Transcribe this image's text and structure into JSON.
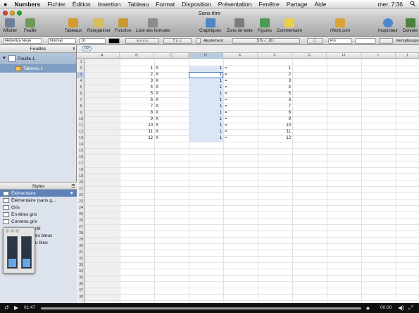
{
  "menubar": {
    "apple_icon": "apple-logo-icon",
    "app_name": "Numbers",
    "items": [
      "Fichier",
      "Édition",
      "Insertion",
      "Tableau",
      "Format",
      "Disposition",
      "Présentation",
      "Fenêtre",
      "Partage",
      "Aide"
    ],
    "clock": "mer. 7:36",
    "spotlight_icon": "search-icon"
  },
  "window": {
    "title": "Sans titre"
  },
  "toolbar": {
    "items": [
      {
        "label": "Afficher",
        "icon": "view-icon",
        "color": "#6f7f97"
      },
      {
        "label": "Feuille",
        "icon": "sheet-icon",
        "color": "#6f9a57"
      },
      {
        "label": "Tableaux",
        "icon": "table-icon",
        "color": "#d59b2f"
      },
      {
        "label": "Réorganiser",
        "icon": "reorganize-icon",
        "color": "#d6bc5d"
      },
      {
        "label": "Fonction",
        "icon": "function-icon",
        "color": "#c99a33"
      },
      {
        "label": "Liste des formules",
        "icon": "formula-list-icon",
        "color": "#8b8b8b"
      },
      {
        "label": "Graphiques",
        "icon": "charts-icon",
        "color": "#4f86c6"
      },
      {
        "label": "Zone de texte",
        "icon": "textbox-icon",
        "color": "#7d7d7d"
      },
      {
        "label": "Figures",
        "icon": "shapes-icon",
        "color": "#4d9a53"
      },
      {
        "label": "Commentaire",
        "icon": "comment-icon",
        "color": "#e7cf46"
      },
      {
        "label": "iWork.com",
        "icon": "iwork-icon",
        "color": "#d9a53a"
      },
      {
        "label": "Inspecteur",
        "icon": "inspector-icon",
        "color": "#4b87c9"
      },
      {
        "label": "Donnée",
        "icon": "data-icon",
        "color": "#4a7f3d"
      }
    ]
  },
  "formatbar": {
    "font": "Helvetica Neue",
    "style": "Normal",
    "size": "10",
    "wrap_label": "Ajustement",
    "number_format": "$ % ✓ ,00 ↕",
    "border_style": "Fin",
    "fill_label": "Remplissage"
  },
  "sidebar": {
    "header": "Feuilles",
    "sheet_name": "Feuille 1",
    "table_name": "Tableau 1"
  },
  "styles_panel": {
    "header": "Styles",
    "items": [
      {
        "label": "Élémentaire",
        "selected": true
      },
      {
        "label": "Élémentaire (sans g…",
        "selected": false
      },
      {
        "label": "Gris",
        "selected": false
      },
      {
        "label": "En-têtes gris",
        "selected": false
      },
      {
        "label": "Contenu gris",
        "selected": false
      },
      {
        "label": "rêt",
        "selected": false
      },
      {
        "label": "es bleus",
        "selected": false
      },
      {
        "label": "u bleu",
        "selected": false
      }
    ]
  },
  "formula_bar": {
    "cell_ref": "D2"
  },
  "grid": {
    "columns": [
      "A",
      "B",
      "C",
      "D",
      "E",
      "F",
      "G",
      "H",
      "I",
      "J"
    ],
    "row_count": 38,
    "selected_column": "D",
    "selected_row": "3",
    "multiplicand": [
      1,
      2,
      3,
      4,
      5,
      6,
      7,
      8,
      9,
      10,
      11,
      12
    ],
    "times_sign": "X",
    "multiplier": [
      1,
      1,
      1,
      1,
      1,
      1,
      1,
      1,
      1,
      1,
      1,
      1
    ],
    "equals_sign": "=",
    "result": [
      1,
      2,
      3,
      4,
      5,
      6,
      7,
      8,
      9,
      10,
      11,
      12
    ]
  },
  "video_controls": {
    "elapsed": "01:47",
    "remaining": "00:00"
  }
}
